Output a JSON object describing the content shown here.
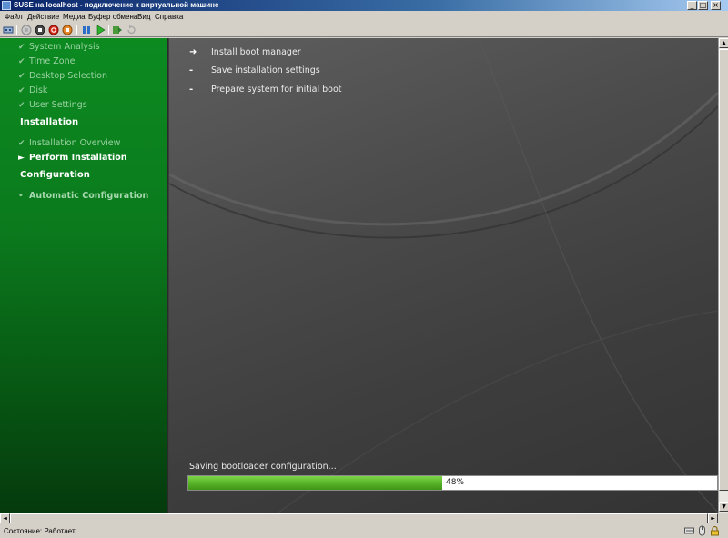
{
  "window": {
    "title": "SUSE на localhost - подключение к виртуальной машине",
    "minimize_label": "_",
    "maximize_label": "□",
    "close_label": "×"
  },
  "menu": {
    "items": [
      "Файл",
      "Действие",
      "Медиа",
      "Буфер обмена",
      "Вид",
      "Справка"
    ]
  },
  "toolbar": {
    "icons": [
      "ctrl-alt-del-icon",
      "start-icon",
      "turn-off-icon",
      "shutdown-icon",
      "save-state-icon",
      "pause-icon",
      "resume-icon",
      "snapshot-icon",
      "revert-icon"
    ]
  },
  "installer": {
    "sidebar": {
      "steps_done": [
        "System Analysis",
        "Time Zone",
        "Desktop Selection",
        "Disk",
        "User Settings"
      ],
      "section_installation": "Installation",
      "installation_done": "Installation Overview",
      "installation_current": "Perform Installation",
      "section_configuration": "Configuration",
      "configuration_pending": "Automatic Configuration",
      "mark_done": "✔",
      "mark_current": "►",
      "mark_pending": "•"
    },
    "tasks": [
      {
        "mark": "➜",
        "label": "Install boot manager"
      },
      {
        "mark": "-",
        "label": "Save installation settings"
      },
      {
        "mark": "-",
        "label": "Prepare system for initial boot"
      }
    ],
    "progress": {
      "label": "Saving bootloader configuration...",
      "value": 0.48,
      "text": "48%",
      "color": "#5cb82b"
    }
  },
  "status_bar": {
    "text": "Состояние: Работает",
    "icons": [
      "keyboard-icon",
      "mouse-icon",
      "lock-icon"
    ]
  },
  "colors": {
    "sidebar_green": "#0b7a1d",
    "content_gray": "#4b4b4b",
    "title_blue": "#0a246a"
  }
}
